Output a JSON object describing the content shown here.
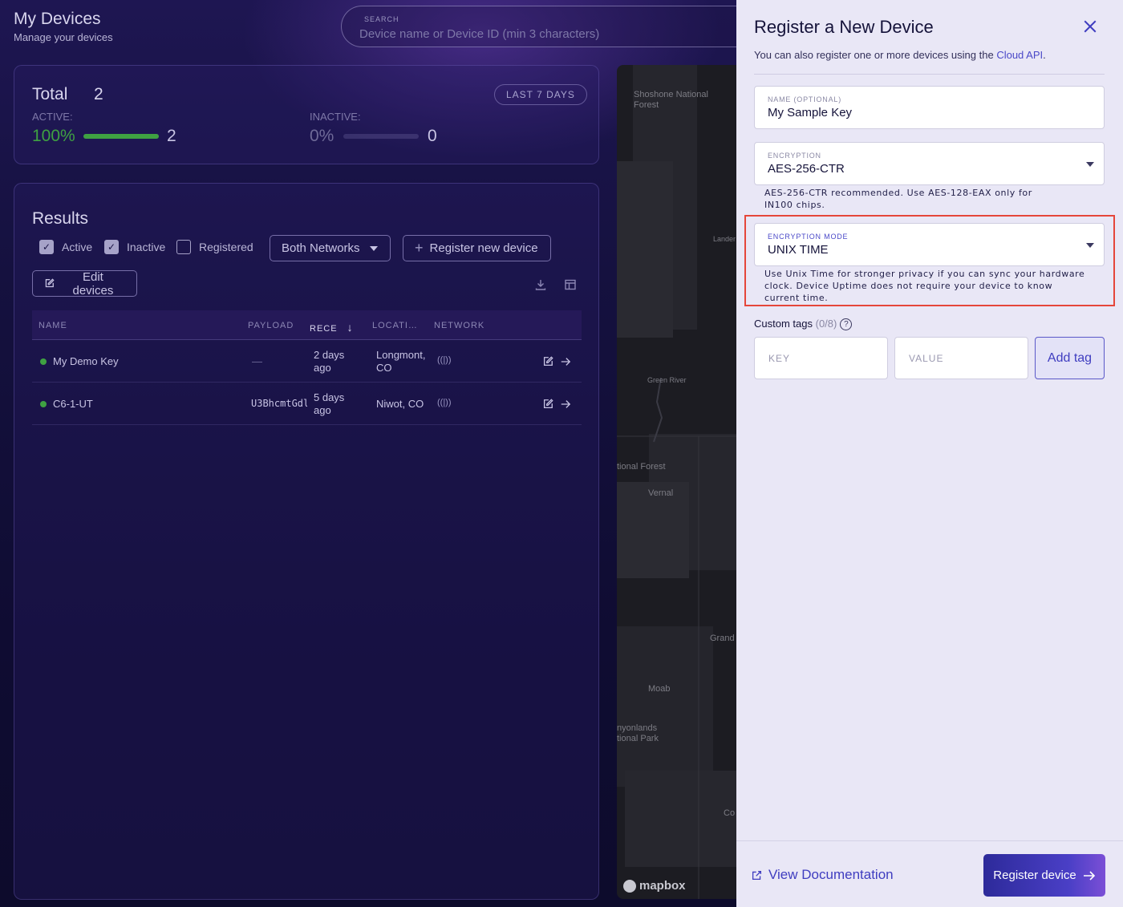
{
  "header": {
    "title": "My Devices",
    "subtitle": "Manage your devices",
    "search_label": "SEARCH",
    "search_placeholder": "Device name or Device ID (min 3 characters)"
  },
  "summary": {
    "total_label": "Total",
    "total_count": "2",
    "range_label": "LAST 7 DAYS",
    "active_label": "ACTIVE:",
    "active_pct": "100%",
    "active_fraction": 1.0,
    "active_count": "2",
    "inactive_label": "INACTIVE:",
    "inactive_pct": "0%",
    "inactive_fraction": 0.0,
    "inactive_count": "0",
    "active_color": "#3fa142",
    "inactive_color": "#6f6a98"
  },
  "results": {
    "title": "Results",
    "filters": [
      {
        "label": "Active",
        "checked": true
      },
      {
        "label": "Inactive",
        "checked": true
      },
      {
        "label": "Registered",
        "checked": false
      }
    ],
    "network_select": "Both Networks",
    "register_button": "Register new device",
    "edit_button": "Edit devices",
    "columns": [
      "NAME",
      "PAYLOAD",
      "RECE",
      "LOCATI…",
      "NETWORK"
    ],
    "rows": [
      {
        "name": "My Demo Key",
        "payload": "—",
        "received": "2 days ago",
        "location": "Longmont, CO"
      },
      {
        "name": "C6-1-UT",
        "payload": "U3BhcmtGdl",
        "received": "5 days ago",
        "location": "Niwot, CO"
      }
    ]
  },
  "map": {
    "labels": [
      "Shoshone National Forest",
      "Lander",
      "Green River",
      "tional Forest",
      "Vernal",
      "Grand",
      "Moab",
      "nyonlands tional Park",
      "Co"
    ],
    "attribution": "mapbox"
  },
  "panel": {
    "title": "Register a New Device",
    "subtitle_prefix": "You can also register one or more devices using the ",
    "subtitle_link": "Cloud API",
    "subtitle_suffix": ".",
    "name_label": "NAME (OPTIONAL)",
    "name_value": "My Sample Key",
    "encryption_label": "ENCRYPTION",
    "encryption_value": "AES-256-CTR",
    "encryption_help": "AES-256-CTR recommended. Use AES-128-EAX only for IN100 chips.",
    "mode_label": "ENCRYPTION MODE",
    "mode_value": "UNIX TIME",
    "mode_help": "Use Unix Time for stronger privacy if you can sync your hardware clock. Device Uptime does not require your device to know current time.",
    "tags_label": "Custom tags",
    "tags_count": "(0/8)",
    "key_placeholder": "KEY",
    "value_placeholder": "VALUE",
    "add_tag": "Add tag",
    "doc_link": "View Documentation",
    "register_button": "Register device",
    "accent_color": "#3f3dc0",
    "highlight_color": "#e5463a"
  }
}
